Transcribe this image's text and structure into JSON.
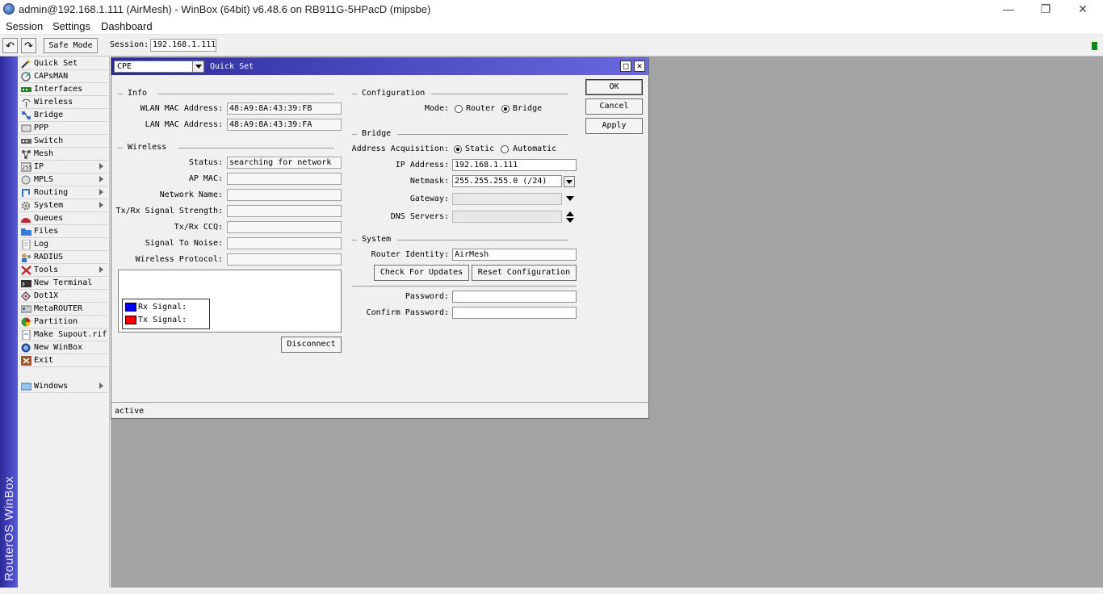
{
  "window": {
    "title": "admin@192.168.1.111 (AirMesh) - WinBox (64bit) v6.48.6 on RB911G-5HPacD (mipsbe)",
    "minimize": "—",
    "restore": "❐",
    "close": "✕"
  },
  "menubar": {
    "session": "Session",
    "settings": "Settings",
    "dashboard": "Dashboard"
  },
  "toolbar": {
    "undo": "↶",
    "redo": "↷",
    "safe_mode": "Safe Mode",
    "session_label": "Session:",
    "session_value": "192.168.1.111"
  },
  "brand": "RouterOS WinBox",
  "sidemenu": {
    "items": [
      {
        "label": "Quick Set",
        "icon": "wand-icon"
      },
      {
        "label": "CAPsMAN",
        "icon": "capsman-icon"
      },
      {
        "label": "Interfaces",
        "icon": "interfaces-icon"
      },
      {
        "label": "Wireless",
        "icon": "wireless-icon"
      },
      {
        "label": "Bridge",
        "icon": "bridge-icon"
      },
      {
        "label": "PPP",
        "icon": "ppp-icon"
      },
      {
        "label": "Switch",
        "icon": "switch-icon"
      },
      {
        "label": "Mesh",
        "icon": "mesh-icon"
      },
      {
        "label": "IP",
        "icon": "ip-icon"
      },
      {
        "label": "MPLS",
        "icon": "mpls-icon"
      },
      {
        "label": "Routing",
        "icon": "routing-icon"
      },
      {
        "label": "System",
        "icon": "system-gear-icon"
      },
      {
        "label": "Queues",
        "icon": "queues-icon"
      },
      {
        "label": "Files",
        "icon": "folder-icon"
      },
      {
        "label": "Log",
        "icon": "log-icon"
      },
      {
        "label": "RADIUS",
        "icon": "radius-icon"
      },
      {
        "label": "Tools",
        "icon": "tools-icon"
      },
      {
        "label": "New Terminal",
        "icon": "terminal-icon"
      },
      {
        "label": "Dot1X",
        "icon": "dot1x-icon"
      },
      {
        "label": "MetaROUTER",
        "icon": "metarouter-icon"
      },
      {
        "label": "Partition",
        "icon": "partition-icon"
      },
      {
        "label": "Make Supout.rif",
        "icon": "supout-icon"
      },
      {
        "label": "New WinBox",
        "icon": "winbox-icon"
      },
      {
        "label": "Exit",
        "icon": "exit-icon"
      },
      {
        "label": "Windows",
        "icon": "windows-icon"
      }
    ]
  },
  "dialog": {
    "mode_select": "CPE",
    "title": "Quick Set",
    "restore_btn": "□",
    "close_btn": "✕",
    "info": {
      "section": "Info",
      "wlan_mac_label": "WLAN MAC Address:",
      "wlan_mac": "48:A9:8A:43:39:FB",
      "lan_mac_label": "LAN MAC Address:",
      "lan_mac": "48:A9:8A:43:39:FA"
    },
    "wireless": {
      "section": "Wireless",
      "status_label": "Status:",
      "status": "searching for network",
      "ap_mac_label": "AP MAC:",
      "network_name_label": "Network Name:",
      "signal_strength_label": "Tx/Rx Signal Strength:",
      "ccq_label": "Tx/Rx CCQ:",
      "snr_label": "Signal To Noise:",
      "protocol_label": "Wireless Protocol:",
      "rx_signal": "Rx Signal:",
      "tx_signal": "Tx Signal:",
      "rx_color": "#0000ff",
      "tx_color": "#ff0000",
      "disconnect": "Disconnect"
    },
    "configuration": {
      "section": "Configuration",
      "mode_label": "Mode:",
      "router": "Router",
      "bridge": "Bridge",
      "selected": "Bridge"
    },
    "bridge": {
      "section": "Bridge",
      "acquisition_label": "Address Acquisition:",
      "static": "Static",
      "automatic": "Automatic",
      "selected": "Static",
      "ip_label": "IP Address:",
      "ip": "192.168.1.111",
      "netmask_label": "Netmask:",
      "netmask": "255.255.255.0 (/24)",
      "gateway_label": "Gateway:",
      "dns_label": "DNS Servers:"
    },
    "system": {
      "section": "System",
      "identity_label": "Router Identity:",
      "identity": "AirMesh",
      "check_updates": "Check For Updates",
      "reset_config": "Reset Configuration",
      "password_label": "Password:",
      "confirm_password_label": "Confirm Password:"
    },
    "buttons": {
      "ok": "OK",
      "cancel": "Cancel",
      "apply": "Apply"
    },
    "status": "active"
  }
}
